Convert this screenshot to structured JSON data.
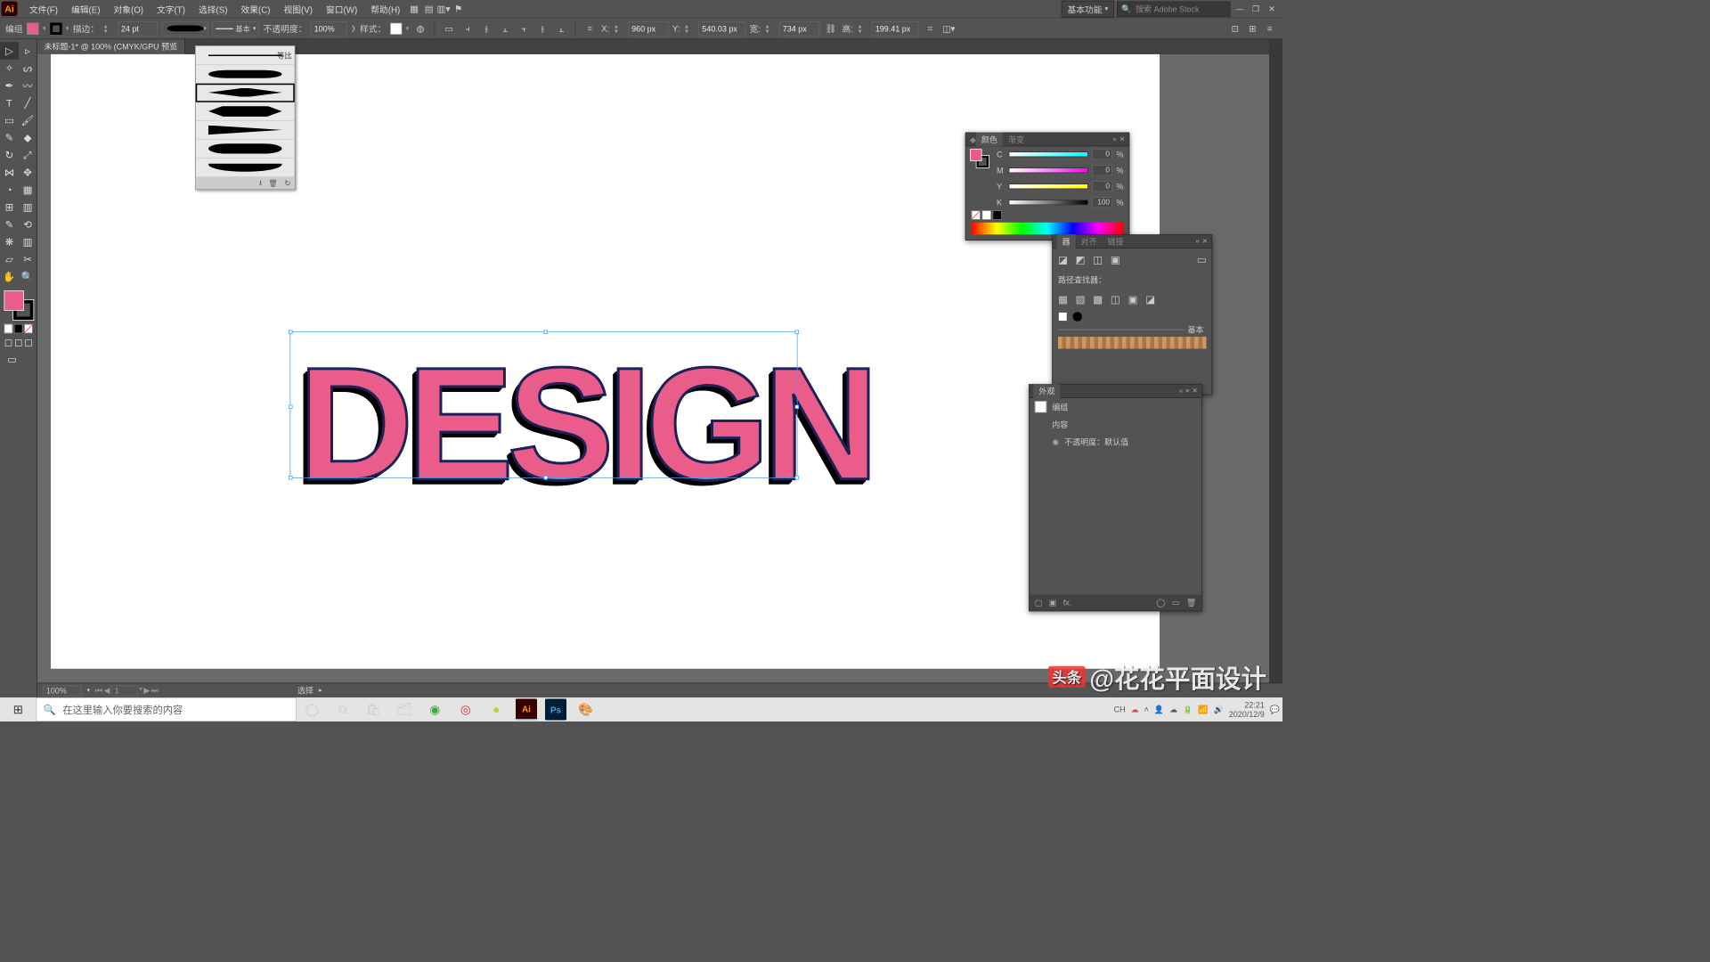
{
  "app": {
    "logo": "Ai",
    "workspace": "基本功能",
    "stock_ph": "搜索 Adobe Stock"
  },
  "menu": [
    "文件(F)",
    "编辑(E)",
    "对象(O)",
    "文字(T)",
    "选择(S)",
    "效果(C)",
    "视图(V)",
    "窗口(W)",
    "帮助(H)"
  ],
  "ctrl": {
    "sel": "编组",
    "fill": "#ea5d8a",
    "stroke_lbl": "描边：",
    "stroke_w": "24 pt",
    "vp_lbl": "基本",
    "opacity_lbl": "不透明度：",
    "opacity": "100%",
    "style_lbl": "样式：",
    "x_lbl": "X:",
    "x": "960 px",
    "y_lbl": "Y:",
    "y": "540.03 px",
    "w_lbl": "宽:",
    "w": "734 px",
    "h_lbl": "高:",
    "h": "199.41 px"
  },
  "brush_presets": [
    "等比",
    "oval",
    "bowtie",
    "diamond",
    "triangle",
    "fatround",
    "halfmoon"
  ],
  "doc": {
    "tab": "未标题-1* @ 100% (CMYK/GPU 预览",
    "canvas_text": "DESIGN"
  },
  "color": {
    "title": "颜色",
    "tab2": "渐变",
    "c": "0",
    "m": "0",
    "y": "0",
    "k": "100"
  },
  "pathfinder": {
    "tab1": "器",
    "tab2": "对齐",
    "tab3": "链接",
    "label": "路径查找器：",
    "basic": "基本"
  },
  "appearance": {
    "title": "外观",
    "row1": "编组",
    "row2": "内容",
    "row3": "不透明度：默认值"
  },
  "status": {
    "zoom": "100%",
    "page": "1",
    "mode": "选择"
  },
  "taskbar": {
    "search_ph": "在这里输入你要搜索的内容",
    "ime": "CH",
    "time": "22:21",
    "date": "2020/12/9"
  },
  "watermark": {
    "brand": "头条",
    "user": "@花花平面设计"
  }
}
